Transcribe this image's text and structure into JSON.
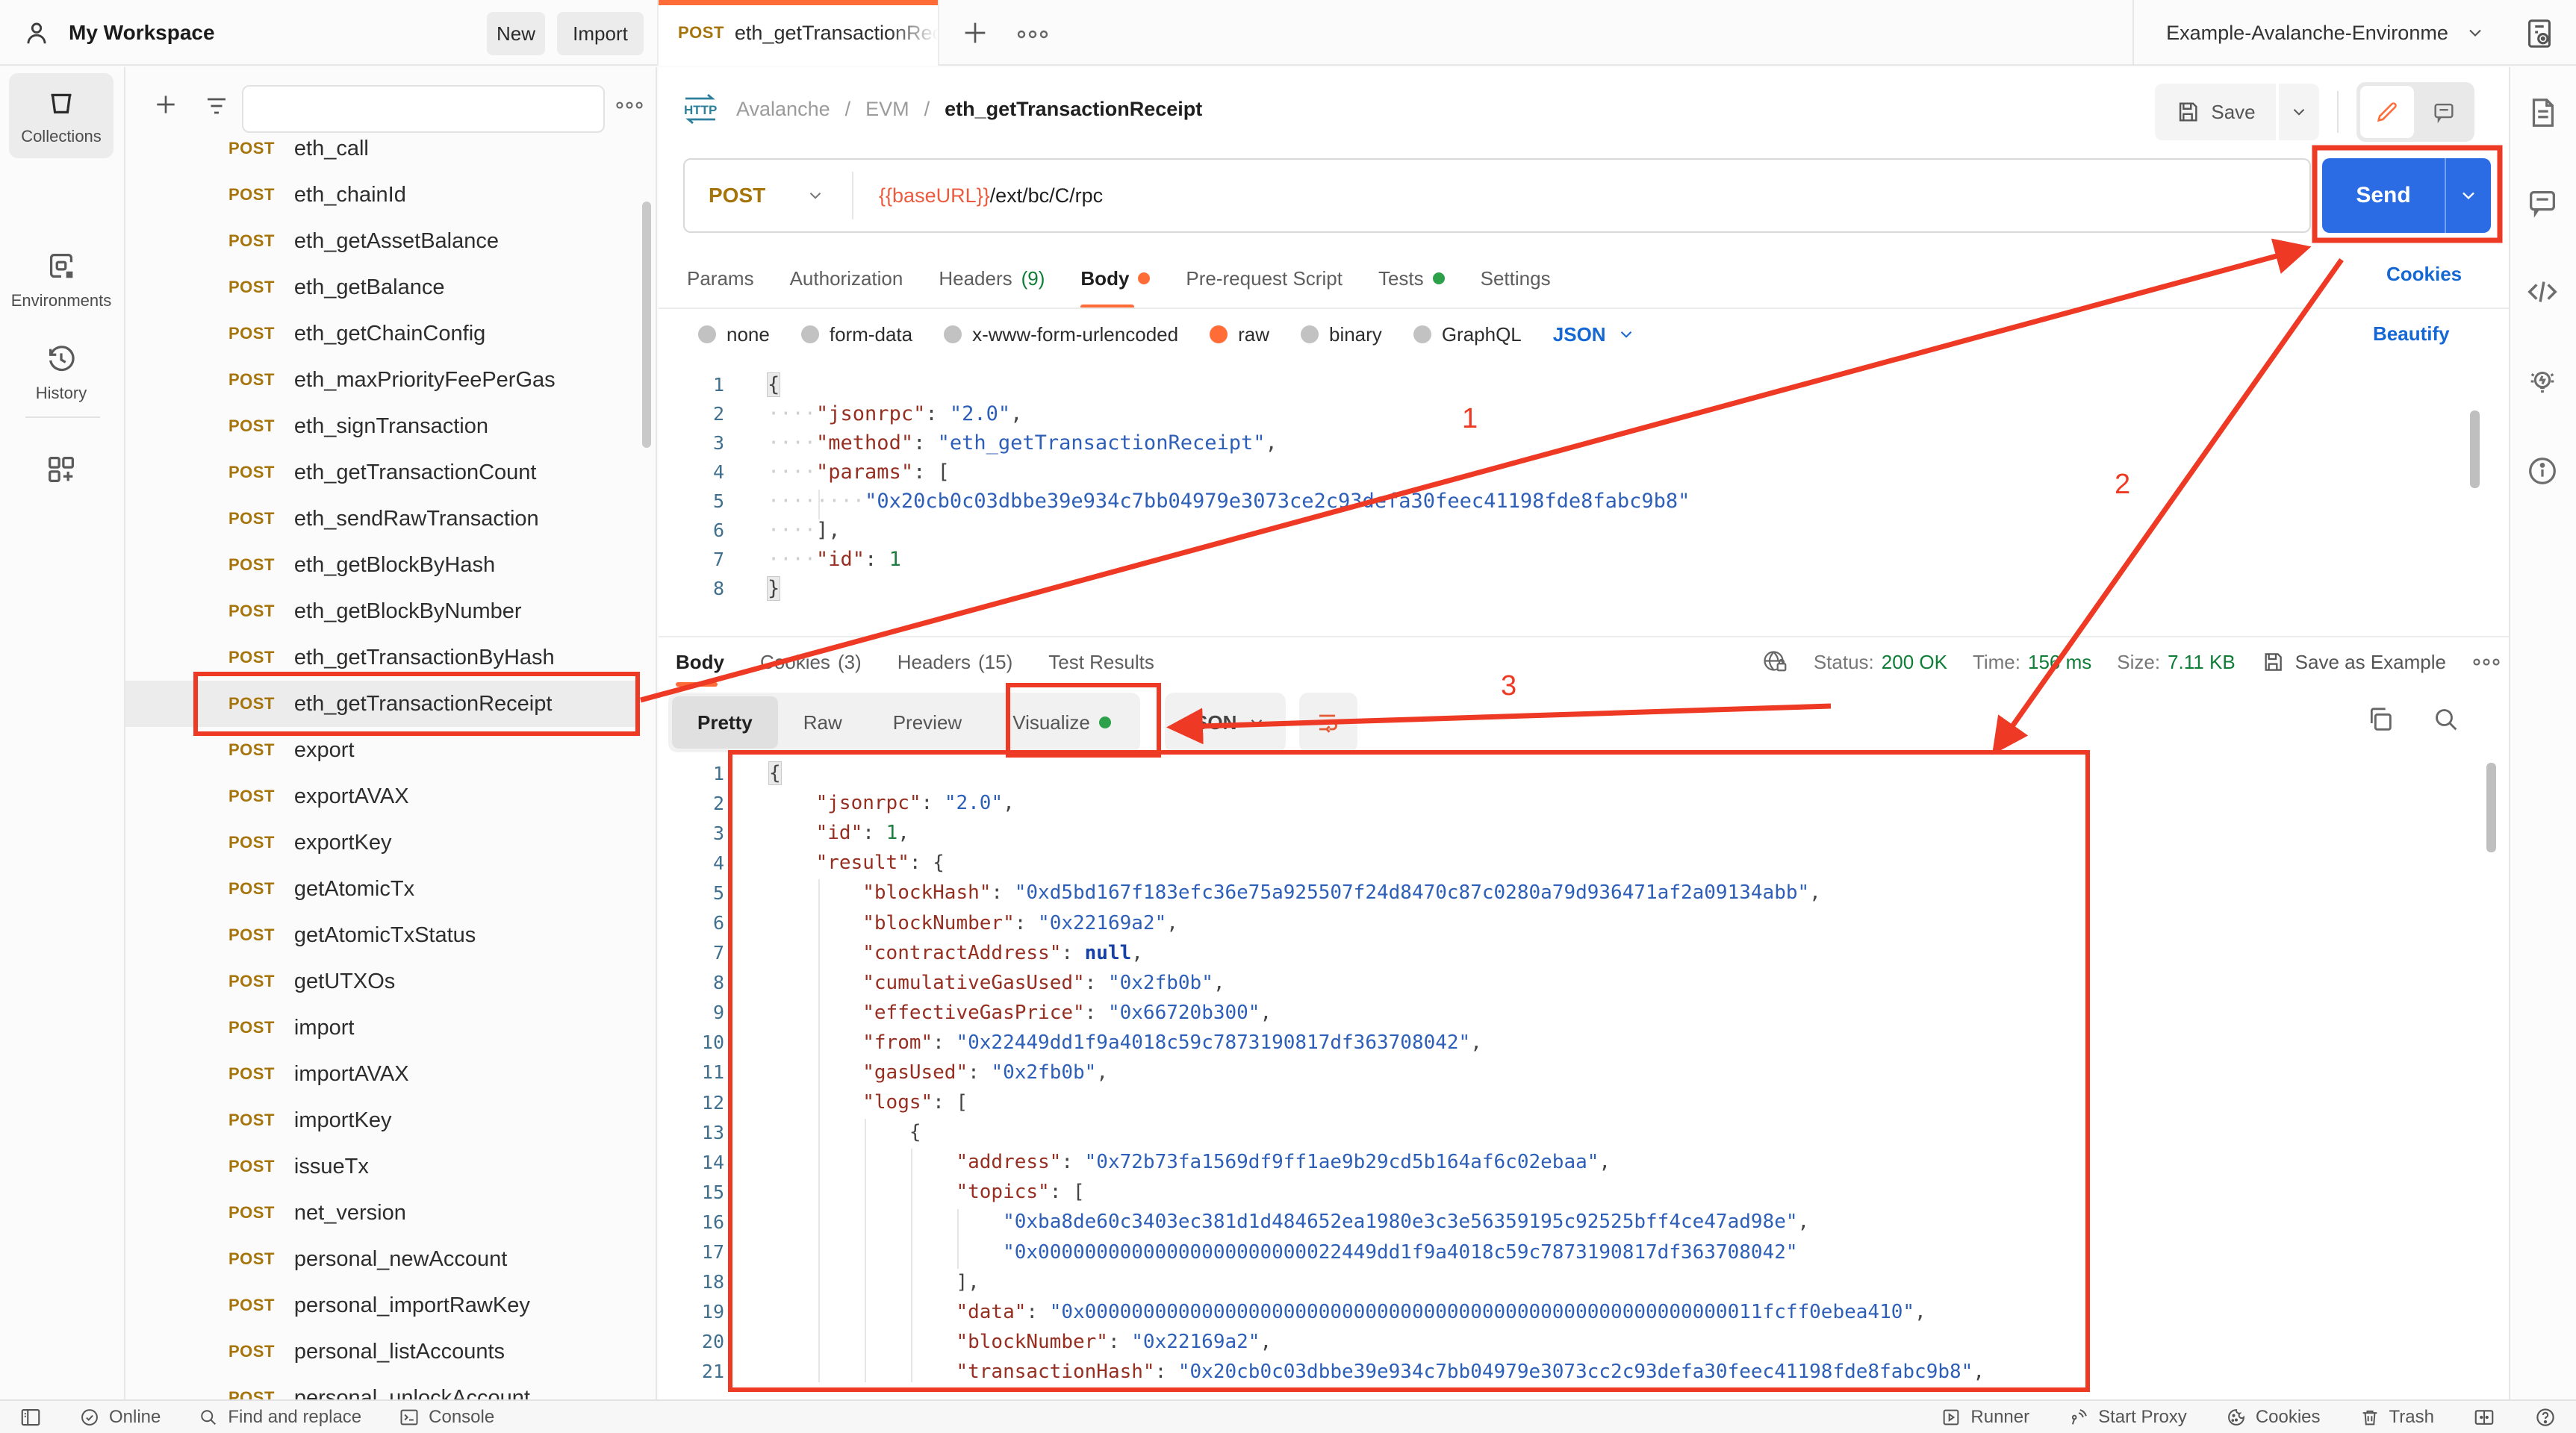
{
  "colors": {
    "accent_orange": "#ff6c37",
    "send_blue": "#2b6ce5",
    "annotation_red": "#ee3a24",
    "status_green": "#0e7d36",
    "link_blue": "#1567d3",
    "method_gold": "#a5740a"
  },
  "topbar": {
    "workspace": "My Workspace",
    "new_label": "New",
    "import_label": "Import",
    "tab_method": "POST",
    "tab_name": "eth_getTransactionRece",
    "environment": "Example-Avalanche-Environme"
  },
  "leftrail": {
    "items": [
      "Collections",
      "Environments",
      "History"
    ],
    "active": "Collections"
  },
  "sidebar": {
    "selected": "eth_getTransactionReceipt",
    "items": [
      {
        "method": "POST",
        "name": "eth_call"
      },
      {
        "method": "POST",
        "name": "eth_chainId"
      },
      {
        "method": "POST",
        "name": "eth_getAssetBalance"
      },
      {
        "method": "POST",
        "name": "eth_getBalance"
      },
      {
        "method": "POST",
        "name": "eth_getChainConfig"
      },
      {
        "method": "POST",
        "name": "eth_maxPriorityFeePerGas"
      },
      {
        "method": "POST",
        "name": "eth_signTransaction"
      },
      {
        "method": "POST",
        "name": "eth_getTransactionCount"
      },
      {
        "method": "POST",
        "name": "eth_sendRawTransaction"
      },
      {
        "method": "POST",
        "name": "eth_getBlockByHash"
      },
      {
        "method": "POST",
        "name": "eth_getBlockByNumber"
      },
      {
        "method": "POST",
        "name": "eth_getTransactionByHash"
      },
      {
        "method": "POST",
        "name": "eth_getTransactionReceipt"
      },
      {
        "method": "POST",
        "name": "export"
      },
      {
        "method": "POST",
        "name": "exportAVAX"
      },
      {
        "method": "POST",
        "name": "exportKey"
      },
      {
        "method": "POST",
        "name": "getAtomicTx"
      },
      {
        "method": "POST",
        "name": "getAtomicTxStatus"
      },
      {
        "method": "POST",
        "name": "getUTXOs"
      },
      {
        "method": "POST",
        "name": "import"
      },
      {
        "method": "POST",
        "name": "importAVAX"
      },
      {
        "method": "POST",
        "name": "importKey"
      },
      {
        "method": "POST",
        "name": "issueTx"
      },
      {
        "method": "POST",
        "name": "net_version"
      },
      {
        "method": "POST",
        "name": "personal_newAccount"
      },
      {
        "method": "POST",
        "name": "personal_importRawKey"
      },
      {
        "method": "POST",
        "name": "personal_listAccounts"
      },
      {
        "method": "POST",
        "name": "personal_unlockAccount"
      }
    ]
  },
  "breadcrumb": {
    "parent1": "Avalanche",
    "sep1": "/",
    "parent2": "EVM",
    "sep2": "/",
    "current": "eth_getTransactionReceipt",
    "save_label": "Save"
  },
  "request": {
    "method": "POST",
    "url_var": "{{baseURL}}",
    "url_path": "/ext/bc/C/rpc",
    "send_label": "Send",
    "cookies_link": "Cookies",
    "beautify_link": "Beautify",
    "tabs": [
      {
        "label": "Params"
      },
      {
        "label": "Authorization"
      },
      {
        "label": "Headers",
        "count": "(9)"
      },
      {
        "label": "Body",
        "dot": "orange",
        "active": true
      },
      {
        "label": "Pre-request Script"
      },
      {
        "label": "Tests",
        "dot": "green"
      },
      {
        "label": "Settings"
      }
    ],
    "body_types": [
      {
        "label": "none"
      },
      {
        "label": "form-data"
      },
      {
        "label": "x-www-form-urlencoded"
      },
      {
        "label": "raw",
        "selected": true
      },
      {
        "label": "binary"
      },
      {
        "label": "GraphQL"
      }
    ],
    "body_lang": "JSON",
    "editor_lines": [
      [
        [
          "p hl",
          "{"
        ]
      ],
      [
        [
          "ws",
          "····"
        ],
        [
          "k",
          "\"jsonrpc\""
        ],
        [
          "p",
          ": "
        ],
        [
          "s",
          "\"2.0\""
        ],
        [
          "p",
          ","
        ]
      ],
      [
        [
          "ws",
          "····"
        ],
        [
          "k",
          "\"method\""
        ],
        [
          "p",
          ": "
        ],
        [
          "s",
          "\"eth_getTransactionReceipt\""
        ],
        [
          "p",
          ","
        ]
      ],
      [
        [
          "ws",
          "····"
        ],
        [
          "k",
          "\"params\""
        ],
        [
          "p",
          ": "
        ],
        [
          "p",
          "["
        ]
      ],
      [
        [
          "ws",
          "····"
        ],
        [
          "ws",
          "····"
        ],
        [
          "s",
          "\"0x20cb0c03dbbe39e934c7bb04979e3073ce2c93defa30feec41198fde8fabc9b8\""
        ]
      ],
      [
        [
          "ws",
          "····"
        ],
        [
          "p",
          "],"
        ]
      ],
      [
        [
          "ws",
          "····"
        ],
        [
          "k",
          "\"id\""
        ],
        [
          "p",
          ": "
        ],
        [
          "n",
          "1"
        ]
      ],
      [
        [
          "p hl",
          "}"
        ]
      ]
    ]
  },
  "response": {
    "meta_tabs": [
      {
        "label": "Body",
        "active": true
      },
      {
        "label": "Cookies",
        "count": "(3)"
      },
      {
        "label": "Headers",
        "count": "(15)"
      },
      {
        "label": "Test Results"
      }
    ],
    "status_label": "Status:",
    "status_value": "200 OK",
    "time_label": "Time:",
    "time_value": "156 ms",
    "size_label": "Size:",
    "size_value": "7.11 KB",
    "save_as_example": "Save as Example",
    "view_tabs": [
      {
        "label": "Pretty",
        "active": true
      },
      {
        "label": "Raw"
      },
      {
        "label": "Preview"
      },
      {
        "label": "Visualize",
        "dot": "green"
      }
    ],
    "lang": "JSON",
    "editor_lines": [
      [
        [
          "p hl",
          "{"
        ]
      ],
      [
        [
          "p",
          "    "
        ],
        [
          "k",
          "\"jsonrpc\""
        ],
        [
          "p",
          ": "
        ],
        [
          "s",
          "\"2.0\""
        ],
        [
          "p",
          ","
        ]
      ],
      [
        [
          "p",
          "    "
        ],
        [
          "k",
          "\"id\""
        ],
        [
          "p",
          ": "
        ],
        [
          "n",
          "1"
        ],
        [
          "p",
          ","
        ]
      ],
      [
        [
          "p",
          "    "
        ],
        [
          "k",
          "\"result\""
        ],
        [
          "p",
          ": {"
        ]
      ],
      [
        [
          "p",
          "        "
        ],
        [
          "k",
          "\"blockHash\""
        ],
        [
          "p",
          ": "
        ],
        [
          "s",
          "\"0xd5bd167f183efc36e75a925507f24d8470c87c0280a79d936471af2a09134abb\""
        ],
        [
          "p",
          ","
        ]
      ],
      [
        [
          "p",
          "        "
        ],
        [
          "k",
          "\"blockNumber\""
        ],
        [
          "p",
          ": "
        ],
        [
          "s",
          "\"0x22169a2\""
        ],
        [
          "p",
          ","
        ]
      ],
      [
        [
          "p",
          "        "
        ],
        [
          "k",
          "\"contractAddress\""
        ],
        [
          "p",
          ": "
        ],
        [
          "nl",
          "null"
        ],
        [
          "p",
          ","
        ]
      ],
      [
        [
          "p",
          "        "
        ],
        [
          "k",
          "\"cumulativeGasUsed\""
        ],
        [
          "p",
          ": "
        ],
        [
          "s",
          "\"0x2fb0b\""
        ],
        [
          "p",
          ","
        ]
      ],
      [
        [
          "p",
          "        "
        ],
        [
          "k",
          "\"effectiveGasPrice\""
        ],
        [
          "p",
          ": "
        ],
        [
          "s",
          "\"0x66720b300\""
        ],
        [
          "p",
          ","
        ]
      ],
      [
        [
          "p",
          "        "
        ],
        [
          "k",
          "\"from\""
        ],
        [
          "p",
          ": "
        ],
        [
          "s",
          "\"0x22449dd1f9a4018c59c7873190817df363708042\""
        ],
        [
          "p",
          ","
        ]
      ],
      [
        [
          "p",
          "        "
        ],
        [
          "k",
          "\"gasUsed\""
        ],
        [
          "p",
          ": "
        ],
        [
          "s",
          "\"0x2fb0b\""
        ],
        [
          "p",
          ","
        ]
      ],
      [
        [
          "p",
          "        "
        ],
        [
          "k",
          "\"logs\""
        ],
        [
          "p",
          ": ["
        ]
      ],
      [
        [
          "p",
          "            {"
        ]
      ],
      [
        [
          "p",
          "                "
        ],
        [
          "k",
          "\"address\""
        ],
        [
          "p",
          ": "
        ],
        [
          "s",
          "\"0x72b73fa1569df9ff1ae9b29cd5b164af6c02ebaa\""
        ],
        [
          "p",
          ","
        ]
      ],
      [
        [
          "p",
          "                "
        ],
        [
          "k",
          "\"topics\""
        ],
        [
          "p",
          ": ["
        ]
      ],
      [
        [
          "p",
          "                    "
        ],
        [
          "s",
          "\"0xba8de60c3403ec381d1d484652ea1980e3c3e56359195c92525bff4ce47ad98e\""
        ],
        [
          "p",
          ","
        ]
      ],
      [
        [
          "p",
          "                    "
        ],
        [
          "s",
          "\"0x00000000000000000000000022449dd1f9a4018c59c7873190817df363708042\""
        ]
      ],
      [
        [
          "p",
          "                ],"
        ]
      ],
      [
        [
          "p",
          "                "
        ],
        [
          "k",
          "\"data\""
        ],
        [
          "p",
          ": "
        ],
        [
          "s",
          "\"0x0000000000000000000000000000000000000000000000000000000011fcff0ebea410\""
        ],
        [
          "p",
          ","
        ]
      ],
      [
        [
          "p",
          "                "
        ],
        [
          "k",
          "\"blockNumber\""
        ],
        [
          "p",
          ": "
        ],
        [
          "s",
          "\"0x22169a2\""
        ],
        [
          "p",
          ","
        ]
      ],
      [
        [
          "p",
          "                "
        ],
        [
          "k",
          "\"transactionHash\""
        ],
        [
          "p",
          ": "
        ],
        [
          "s",
          "\"0x20cb0c03dbbe39e934c7bb04979e3073cc2c93defa30feec41198fde8fabc9b8\""
        ],
        [
          "p",
          ","
        ]
      ]
    ]
  },
  "statusbar": {
    "online": "Online",
    "find": "Find and replace",
    "console": "Console",
    "runner": "Runner",
    "proxy": "Start Proxy",
    "cookies": "Cookies",
    "trash": "Trash"
  },
  "annotations": {
    "labels": [
      "1",
      "2",
      "3"
    ]
  }
}
